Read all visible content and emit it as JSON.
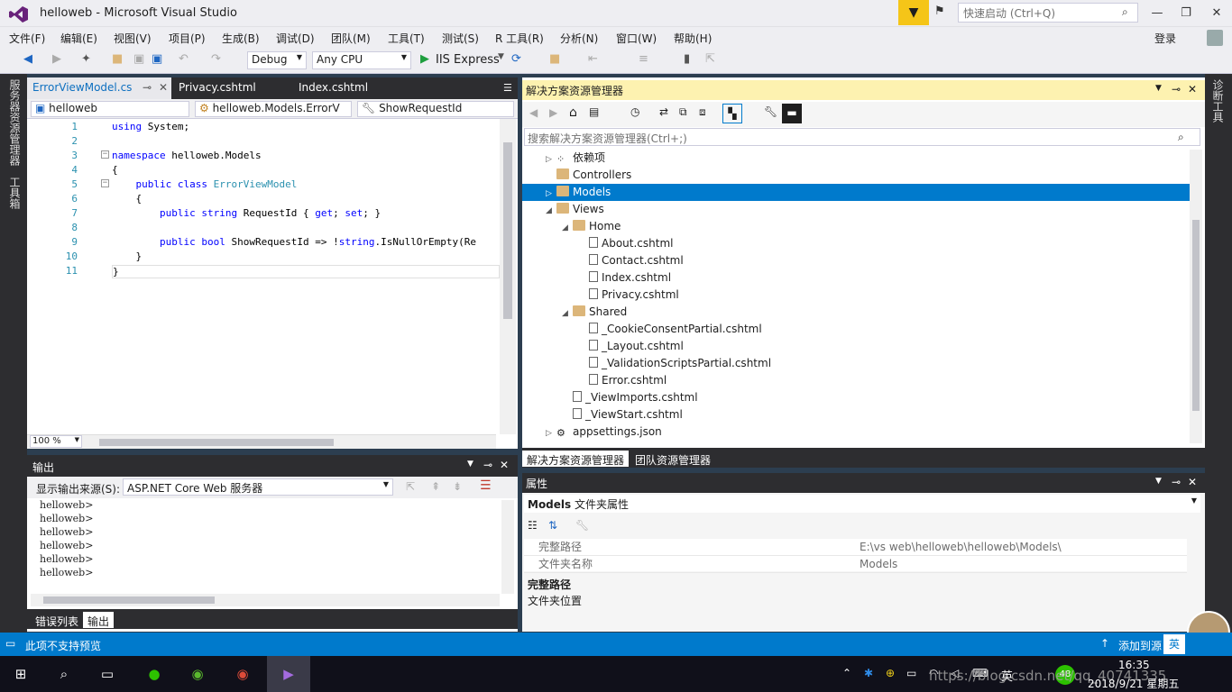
{
  "window": {
    "title": "helloweb - Microsoft Visual Studio",
    "quick_launch_placeholder": "快速启动 (Ctrl+Q)"
  },
  "menu": [
    "文件(F)",
    "编辑(E)",
    "视图(V)",
    "项目(P)",
    "生成(B)",
    "调试(D)",
    "团队(M)",
    "工具(T)",
    "测试(S)",
    "R 工具(R)",
    "分析(N)",
    "窗口(W)",
    "帮助(H)"
  ],
  "account": {
    "login_label": "登录"
  },
  "toolbar": {
    "config": "Debug",
    "platform": "Any CPU",
    "run_label": "IIS Express"
  },
  "left_strip_tabs": [
    "服务器资源管理器",
    "工具箱"
  ],
  "right_strip_tabs": [
    "诊断工具"
  ],
  "editor": {
    "tabs": [
      "ErrorViewModel.cs",
      "Privacy.cshtml",
      "Index.cshtml"
    ],
    "nav": {
      "project": "helloweb",
      "class": "helloweb.Models.ErrorV",
      "member": "ShowRequestId"
    },
    "zoom": "100 %",
    "lines": [
      {
        "n": "1",
        "text": "using System;"
      },
      {
        "n": "2",
        "text": ""
      },
      {
        "n": "3",
        "text": "namespace helloweb.Models"
      },
      {
        "n": "4",
        "text": "{"
      },
      {
        "n": "5",
        "text": "    public class ErrorViewModel"
      },
      {
        "n": "6",
        "text": "    {"
      },
      {
        "n": "7",
        "text": "        public string RequestId { get; set; }"
      },
      {
        "n": "8",
        "text": ""
      },
      {
        "n": "9",
        "text": "        public bool ShowRequestId => !string.IsNullOrEmpty(Re"
      },
      {
        "n": "10",
        "text": "    }"
      },
      {
        "n": "11",
        "text": "}"
      }
    ]
  },
  "output": {
    "title": "输出",
    "source_label": "显示输出来源(S):",
    "source_value": "ASP.NET Core Web 服务器",
    "lines": [
      "helloweb>",
      "helloweb>",
      "helloweb>",
      "helloweb>",
      "helloweb>",
      "helloweb>"
    ],
    "bottom_tabs": [
      "错误列表",
      "输出"
    ]
  },
  "solution_explorer": {
    "title": "解决方案资源管理器",
    "search_placeholder": "搜索解决方案资源管理器(Ctrl+;)",
    "items": [
      {
        "label": "依赖项",
        "indent": 1,
        "expander": "collapsed",
        "icon": "dependencies-icon"
      },
      {
        "label": "Controllers",
        "indent": 1,
        "expander": "none",
        "icon": "folder-icon"
      },
      {
        "label": "Models",
        "indent": 1,
        "expander": "collapsed",
        "icon": "folder-icon",
        "selected": true
      },
      {
        "label": "Views",
        "indent": 1,
        "expander": "expanded",
        "icon": "folder-icon"
      },
      {
        "label": "Home",
        "indent": 2,
        "expander": "expanded",
        "icon": "folder-icon"
      },
      {
        "label": "About.cshtml",
        "indent": 3,
        "expander": "none",
        "icon": "file-icon"
      },
      {
        "label": "Contact.cshtml",
        "indent": 3,
        "expander": "none",
        "icon": "file-icon"
      },
      {
        "label": "Index.cshtml",
        "indent": 3,
        "expander": "none",
        "icon": "file-icon"
      },
      {
        "label": "Privacy.cshtml",
        "indent": 3,
        "expander": "none",
        "icon": "file-icon"
      },
      {
        "label": "Shared",
        "indent": 2,
        "expander": "expanded",
        "icon": "folder-icon"
      },
      {
        "label": "_CookieConsentPartial.cshtml",
        "indent": 3,
        "expander": "none",
        "icon": "file-icon"
      },
      {
        "label": "_Layout.cshtml",
        "indent": 3,
        "expander": "none",
        "icon": "file-icon"
      },
      {
        "label": "_ValidationScriptsPartial.cshtml",
        "indent": 3,
        "expander": "none",
        "icon": "file-icon"
      },
      {
        "label": "Error.cshtml",
        "indent": 3,
        "expander": "none",
        "icon": "file-icon"
      },
      {
        "label": "_ViewImports.cshtml",
        "indent": 2,
        "expander": "none",
        "icon": "file-icon"
      },
      {
        "label": "_ViewStart.cshtml",
        "indent": 2,
        "expander": "none",
        "icon": "file-icon"
      },
      {
        "label": "appsettings.json",
        "indent": 1,
        "expander": "collapsed",
        "icon": "json-icon"
      }
    ],
    "bottom_tabs": [
      "解决方案资源管理器",
      "团队资源管理器"
    ]
  },
  "properties": {
    "title": "属性",
    "selected_name": "Models",
    "selected_type": "文件夹属性",
    "rows": [
      {
        "name": "完整路径",
        "value": "E:\\vs web\\helloweb\\helloweb\\Models\\"
      },
      {
        "name": "文件夹名称",
        "value": "Models"
      }
    ],
    "desc_title": "完整路径",
    "desc_text": "文件夹位置"
  },
  "status": {
    "message": "此项不支持预览",
    "publish": "添加到源",
    "ime": "英"
  },
  "taskbar": {
    "time": "16:35",
    "date": "2018/9/21 星期五",
    "ime": "英",
    "battery": "48",
    "watermark": "https://blog.csdn.net/qq_40741335"
  },
  "colors": {
    "accent": "#007acc",
    "dark": "#2d2d30",
    "se_header": "#fdf2b0"
  }
}
